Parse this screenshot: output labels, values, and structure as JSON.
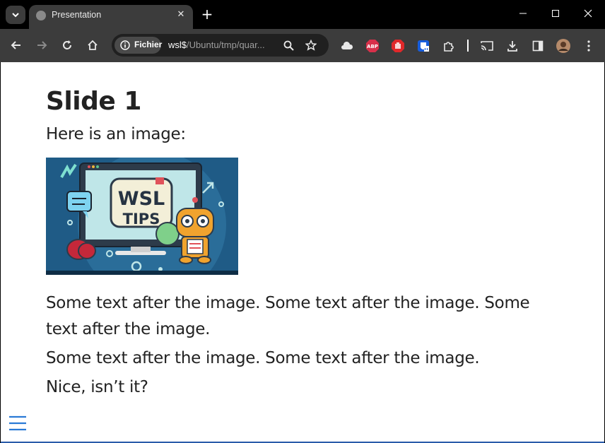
{
  "browser": {
    "tab_title": "Presentation",
    "omnibox": {
      "site_chip_label": "Fichier",
      "url_host": "wsl$",
      "url_path": "/Ubuntu/tmp/quar..."
    }
  },
  "slide": {
    "title": "Slide 1",
    "intro": "Here is an image:",
    "image": {
      "screen_line1": "WSL",
      "screen_line2": "TIPS"
    },
    "paragraphs": [
      "Some text after the image. Some text after the image. Some text after the image.",
      "Some text after the image. Some text after the image.",
      "Nice, isn’t it?"
    ]
  },
  "colors": {
    "chrome_bg": "#000000",
    "toolbar_bg": "#3c3c3c",
    "menu_accent": "#2a7ad6"
  }
}
